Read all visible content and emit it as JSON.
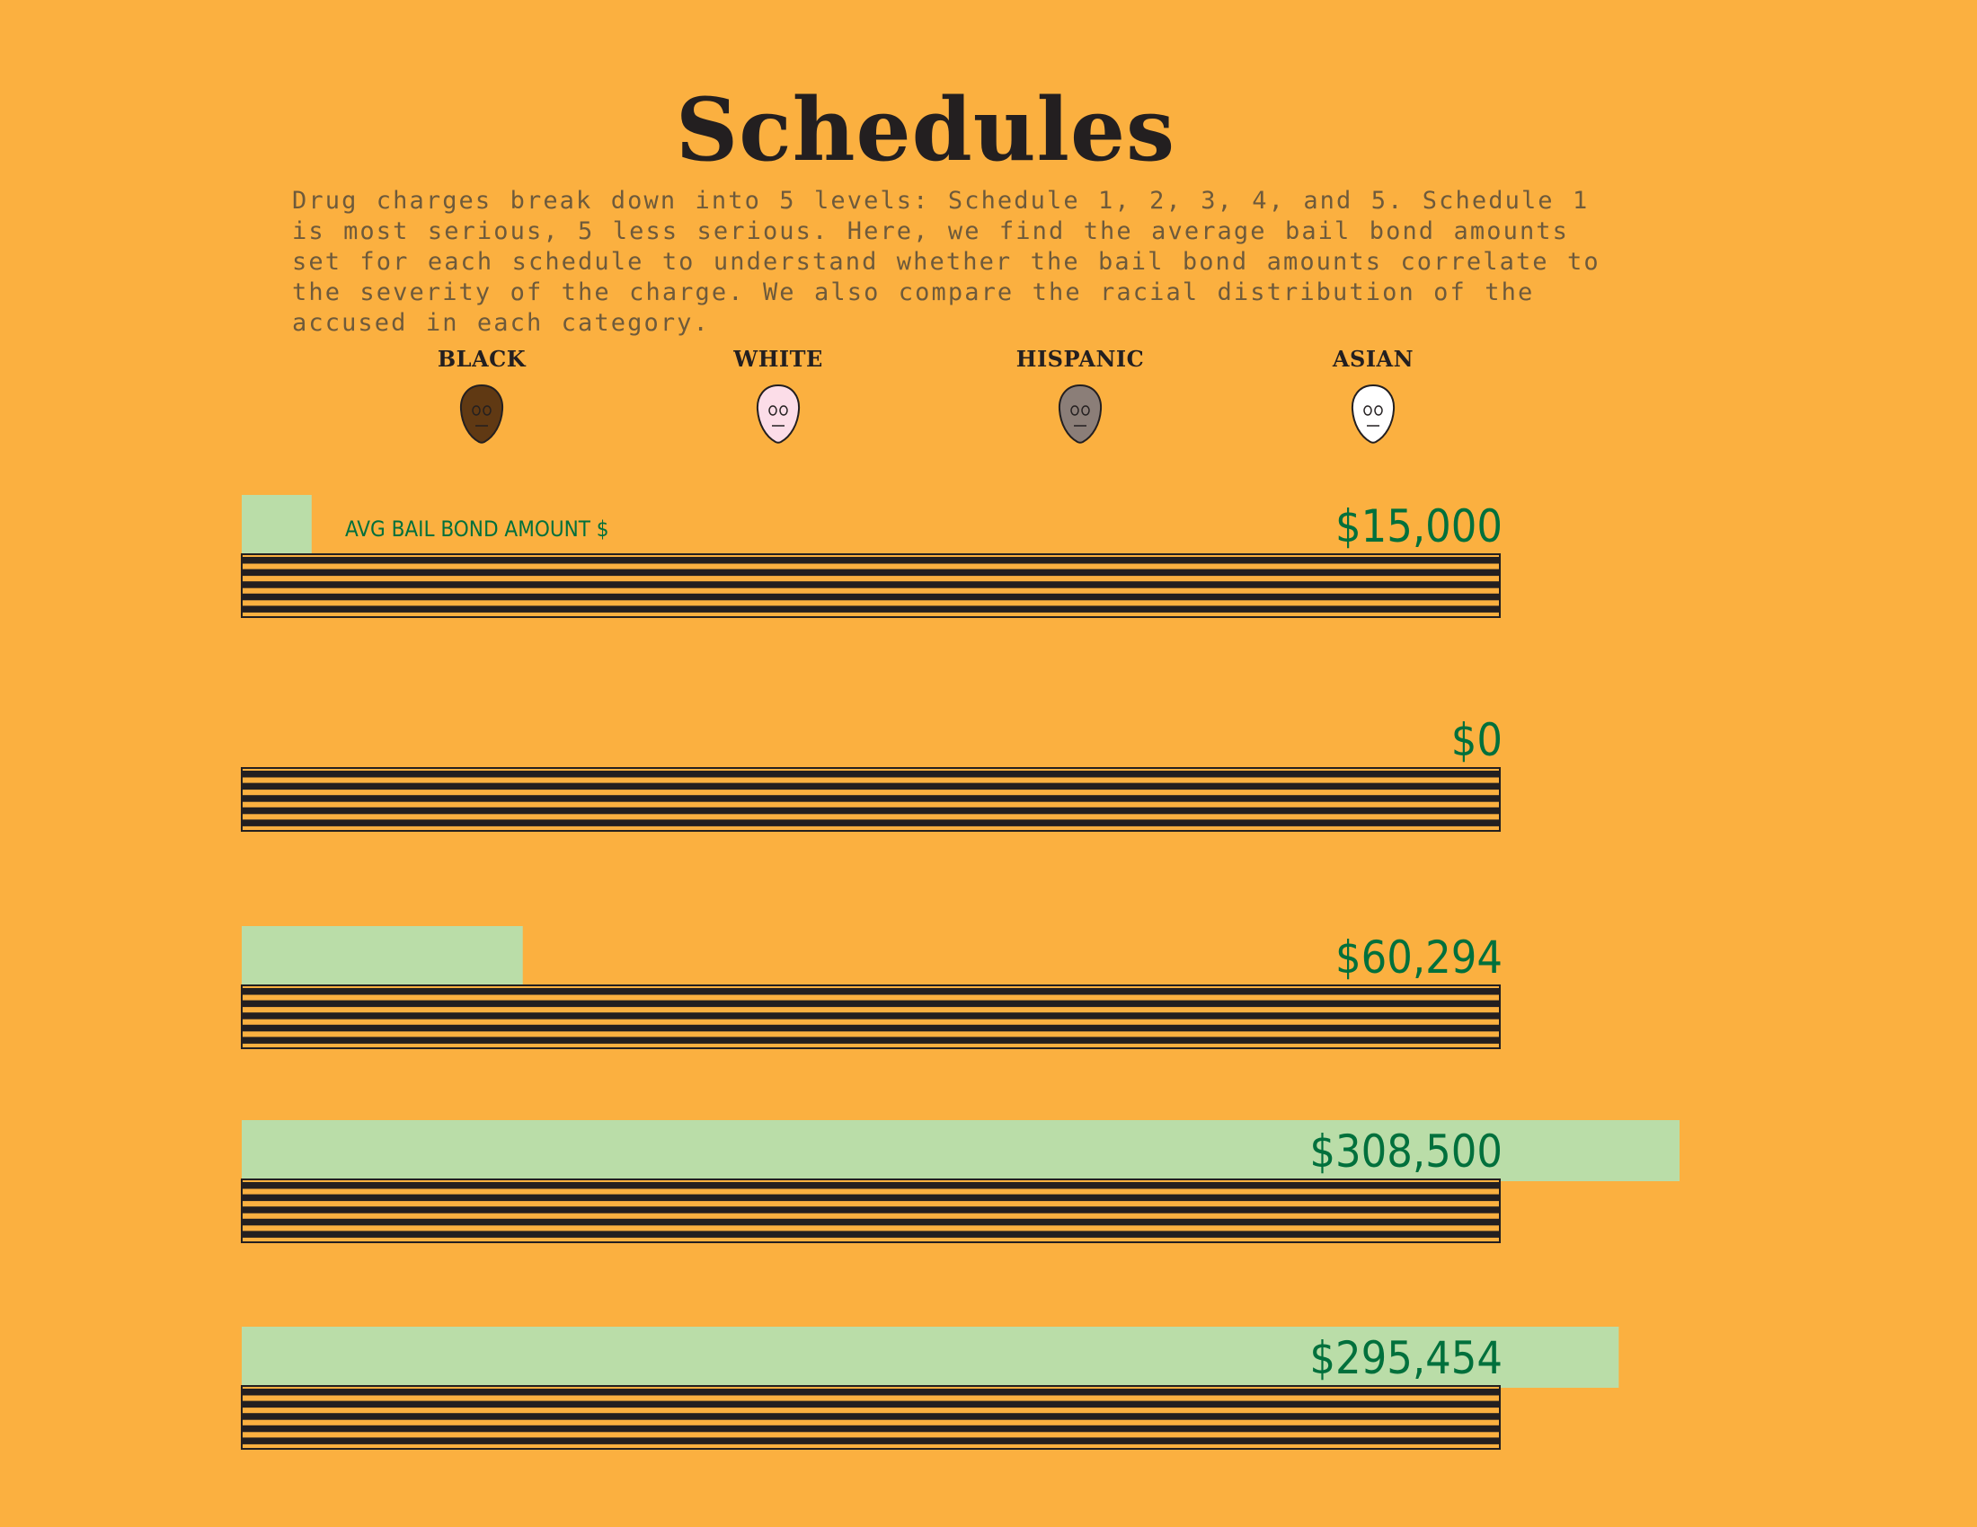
{
  "title": "Schedules",
  "intro": "Drug charges break down into 5 levels: Schedule 1, 2, 3, 4, and 5. Schedule 1 is most serious, 5 less serious. Here, we find the average bail bond amounts set for each schedule to understand whether the bail bond amounts correlate to the severity of the charge. We also compare the racial distribution of the accused in each category.",
  "legend": [
    {
      "label": "BLACK",
      "icon": "black-face-icon",
      "color": "#603913"
    },
    {
      "label": "WHITE",
      "icon": "white-face-icon",
      "color": "#FCDDE8"
    },
    {
      "label": "HISPANIC",
      "icon": "hispanic-face-icon",
      "color": "#8B7E78"
    },
    {
      "label": "ASIAN",
      "icon": "asian-face-icon",
      "color": "#FFFFFF"
    }
  ],
  "colors": {
    "background": "#FBB040",
    "bond_bar": "#BADDA8",
    "bond_text": "#00703C",
    "stripe": "#231F20"
  },
  "chart_data": {
    "type": "bar",
    "series_name": "AVG BAIL BOND AMOUNT $",
    "scale_max": 308500,
    "bars": [
      {
        "value": 15000,
        "label": "$15,000"
      },
      {
        "value": 0,
        "label": "$0"
      },
      {
        "value": 60294,
        "label": "$60,294"
      },
      {
        "value": 308500,
        "label": "$308,500"
      },
      {
        "value": 295454,
        "label": "$295,454"
      }
    ]
  }
}
